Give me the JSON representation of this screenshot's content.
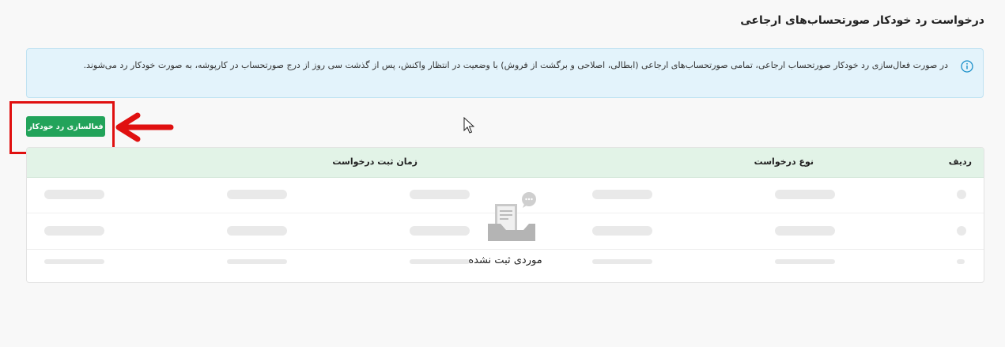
{
  "page": {
    "title": "درخواست رد خودکار صورتحساب‌های ارجاعی"
  },
  "info": {
    "icon": "info-icon",
    "text": "در صورت فعال‌سازی رد خودکار صورتحساب ارجاعی، تمامی صورتحساب‌های ارجاعی (ابطالی، اصلاحی و برگشت از فروش) با وضعیت در انتظار واکنش، پس از گذشت سی روز از درج صورتحساب در کارپوشه، به صورت خودکار رد می‌شوند."
  },
  "actions": {
    "activate_label": "فعالسازی رد خودکار"
  },
  "table": {
    "columns": {
      "index": "ردیف",
      "type": "نوع درخواست",
      "time": "زمان ثبت درخواست"
    },
    "empty_message": "موردی ثبت نشده",
    "empty_icon": "empty-inbox-icon"
  },
  "colors": {
    "accent": "#22a35a",
    "info_bg": "#e3f3fb",
    "header_bg": "#e2f3e7",
    "annotation": "#e01010"
  }
}
